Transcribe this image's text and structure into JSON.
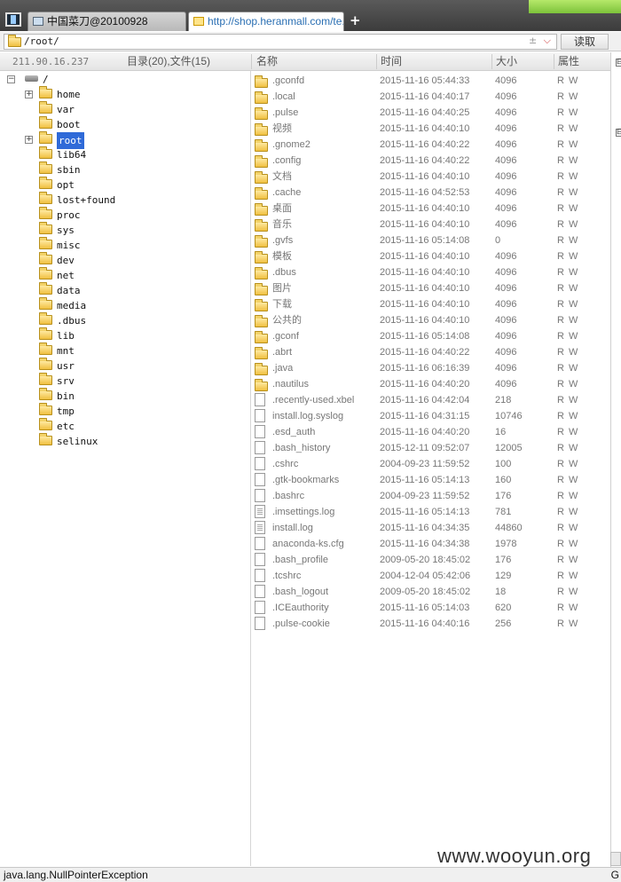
{
  "browser": {
    "tabs": [
      {
        "label": "中国菜刀@20100928"
      },
      {
        "label": "http://shop.heranmall.com/te..."
      }
    ],
    "new_tab": "+"
  },
  "toolbar": {
    "path": "/root/",
    "read_button": "读取",
    "controls": "±"
  },
  "header": {
    "ip": "211.90.16.237",
    "summary": "目录(20),文件(15)",
    "col_name": "名称",
    "col_time": "时间",
    "col_size": "大小",
    "col_attr": "属性"
  },
  "tree": {
    "root": "/",
    "items": [
      {
        "label": "home",
        "expander": "+"
      },
      {
        "label": "var",
        "expander": ""
      },
      {
        "label": "boot",
        "expander": ""
      },
      {
        "label": "root",
        "expander": "+",
        "selected": true
      },
      {
        "label": "lib64",
        "expander": ""
      },
      {
        "label": "sbin",
        "expander": ""
      },
      {
        "label": "opt",
        "expander": ""
      },
      {
        "label": "lost+found",
        "expander": ""
      },
      {
        "label": "proc",
        "expander": ""
      },
      {
        "label": "sys",
        "expander": ""
      },
      {
        "label": "misc",
        "expander": ""
      },
      {
        "label": "dev",
        "expander": ""
      },
      {
        "label": "net",
        "expander": ""
      },
      {
        "label": "data",
        "expander": ""
      },
      {
        "label": "media",
        "expander": ""
      },
      {
        "label": ".dbus",
        "expander": ""
      },
      {
        "label": "lib",
        "expander": ""
      },
      {
        "label": "mnt",
        "expander": ""
      },
      {
        "label": "usr",
        "expander": ""
      },
      {
        "label": "srv",
        "expander": ""
      },
      {
        "label": "bin",
        "expander": ""
      },
      {
        "label": "tmp",
        "expander": ""
      },
      {
        "label": "etc",
        "expander": ""
      },
      {
        "label": "selinux",
        "expander": ""
      }
    ]
  },
  "files": [
    {
      "name": ".gconfd",
      "time": "2015-11-16 05:44:33",
      "size": "4096",
      "attr": "R W",
      "type": "folder"
    },
    {
      "name": ".local",
      "time": "2015-11-16 04:40:17",
      "size": "4096",
      "attr": "R W",
      "type": "folder"
    },
    {
      "name": ".pulse",
      "time": "2015-11-16 04:40:25",
      "size": "4096",
      "attr": "R W",
      "type": "folder"
    },
    {
      "name": "视频",
      "time": "2015-11-16 04:40:10",
      "size": "4096",
      "attr": "R W",
      "type": "folder"
    },
    {
      "name": ".gnome2",
      "time": "2015-11-16 04:40:22",
      "size": "4096",
      "attr": "R W",
      "type": "folder"
    },
    {
      "name": ".config",
      "time": "2015-11-16 04:40:22",
      "size": "4096",
      "attr": "R W",
      "type": "folder"
    },
    {
      "name": "文档",
      "time": "2015-11-16 04:40:10",
      "size": "4096",
      "attr": "R W",
      "type": "folder"
    },
    {
      "name": ".cache",
      "time": "2015-11-16 04:52:53",
      "size": "4096",
      "attr": "R W",
      "type": "folder"
    },
    {
      "name": "桌面",
      "time": "2015-11-16 04:40:10",
      "size": "4096",
      "attr": "R W",
      "type": "folder"
    },
    {
      "name": "音乐",
      "time": "2015-11-16 04:40:10",
      "size": "4096",
      "attr": "R W",
      "type": "folder"
    },
    {
      "name": ".gvfs",
      "time": "2015-11-16 05:14:08",
      "size": "0",
      "attr": "R W",
      "type": "folder"
    },
    {
      "name": "模板",
      "time": "2015-11-16 04:40:10",
      "size": "4096",
      "attr": "R W",
      "type": "folder"
    },
    {
      "name": ".dbus",
      "time": "2015-11-16 04:40:10",
      "size": "4096",
      "attr": "R W",
      "type": "folder"
    },
    {
      "name": "图片",
      "time": "2015-11-16 04:40:10",
      "size": "4096",
      "attr": "R W",
      "type": "folder"
    },
    {
      "name": "下载",
      "time": "2015-11-16 04:40:10",
      "size": "4096",
      "attr": "R W",
      "type": "folder"
    },
    {
      "name": "公共的",
      "time": "2015-11-16 04:40:10",
      "size": "4096",
      "attr": "R W",
      "type": "folder"
    },
    {
      "name": ".gconf",
      "time": "2015-11-16 05:14:08",
      "size": "4096",
      "attr": "R W",
      "type": "folder"
    },
    {
      "name": ".abrt",
      "time": "2015-11-16 04:40:22",
      "size": "4096",
      "attr": "R W",
      "type": "folder"
    },
    {
      "name": ".java",
      "time": "2015-11-16 06:16:39",
      "size": "4096",
      "attr": "R W",
      "type": "folder"
    },
    {
      "name": ".nautilus",
      "time": "2015-11-16 04:40:20",
      "size": "4096",
      "attr": "R W",
      "type": "folder"
    },
    {
      "name": ".recently-used.xbel",
      "time": "2015-11-16 04:42:04",
      "size": "218",
      "attr": "R W",
      "type": "file"
    },
    {
      "name": "install.log.syslog",
      "time": "2015-11-16 04:31:15",
      "size": "10746",
      "attr": "R W",
      "type": "file"
    },
    {
      "name": ".esd_auth",
      "time": "2015-11-16 04:40:20",
      "size": "16",
      "attr": "R W",
      "type": "file"
    },
    {
      "name": ".bash_history",
      "time": "2015-12-11 09:52:07",
      "size": "12005",
      "attr": "R W",
      "type": "file"
    },
    {
      "name": ".cshrc",
      "time": "2004-09-23 11:59:52",
      "size": "100",
      "attr": "R W",
      "type": "file"
    },
    {
      "name": ".gtk-bookmarks",
      "time": "2015-11-16 05:14:13",
      "size": "160",
      "attr": "R W",
      "type": "file"
    },
    {
      "name": ".bashrc",
      "time": "2004-09-23 11:59:52",
      "size": "176",
      "attr": "R W",
      "type": "file"
    },
    {
      "name": ".imsettings.log",
      "time": "2015-11-16 05:14:13",
      "size": "781",
      "attr": "R W",
      "type": "text"
    },
    {
      "name": "install.log",
      "time": "2015-11-16 04:34:35",
      "size": "44860",
      "attr": "R W",
      "type": "text"
    },
    {
      "name": "anaconda-ks.cfg",
      "time": "2015-11-16 04:34:38",
      "size": "1978",
      "attr": "R W",
      "type": "file"
    },
    {
      "name": ".bash_profile",
      "time": "2009-05-20 18:45:02",
      "size": "176",
      "attr": "R W",
      "type": "file"
    },
    {
      "name": ".tcshrc",
      "time": "2004-12-04 05:42:06",
      "size": "129",
      "attr": "R W",
      "type": "file"
    },
    {
      "name": ".bash_logout",
      "time": "2009-05-20 18:45:02",
      "size": "18",
      "attr": "R W",
      "type": "file"
    },
    {
      "name": ".ICEauthority",
      "time": "2015-11-16 05:14:03",
      "size": "620",
      "attr": "R W",
      "type": "file"
    },
    {
      "name": ".pulse-cookie",
      "time": "2015-11-16 04:40:16",
      "size": "256",
      "attr": "R W",
      "type": "file"
    }
  ],
  "right_pane": {
    "markers": [
      "⊟",
      "⊟"
    ]
  },
  "status": {
    "message": "java.lang.NullPointerException",
    "right": "G"
  },
  "watermark": "www.wooyun.org",
  "colors": {
    "selection": "#2f6ad8",
    "folder": "#f0c040",
    "tab_active_text": "#2a6fb3"
  }
}
